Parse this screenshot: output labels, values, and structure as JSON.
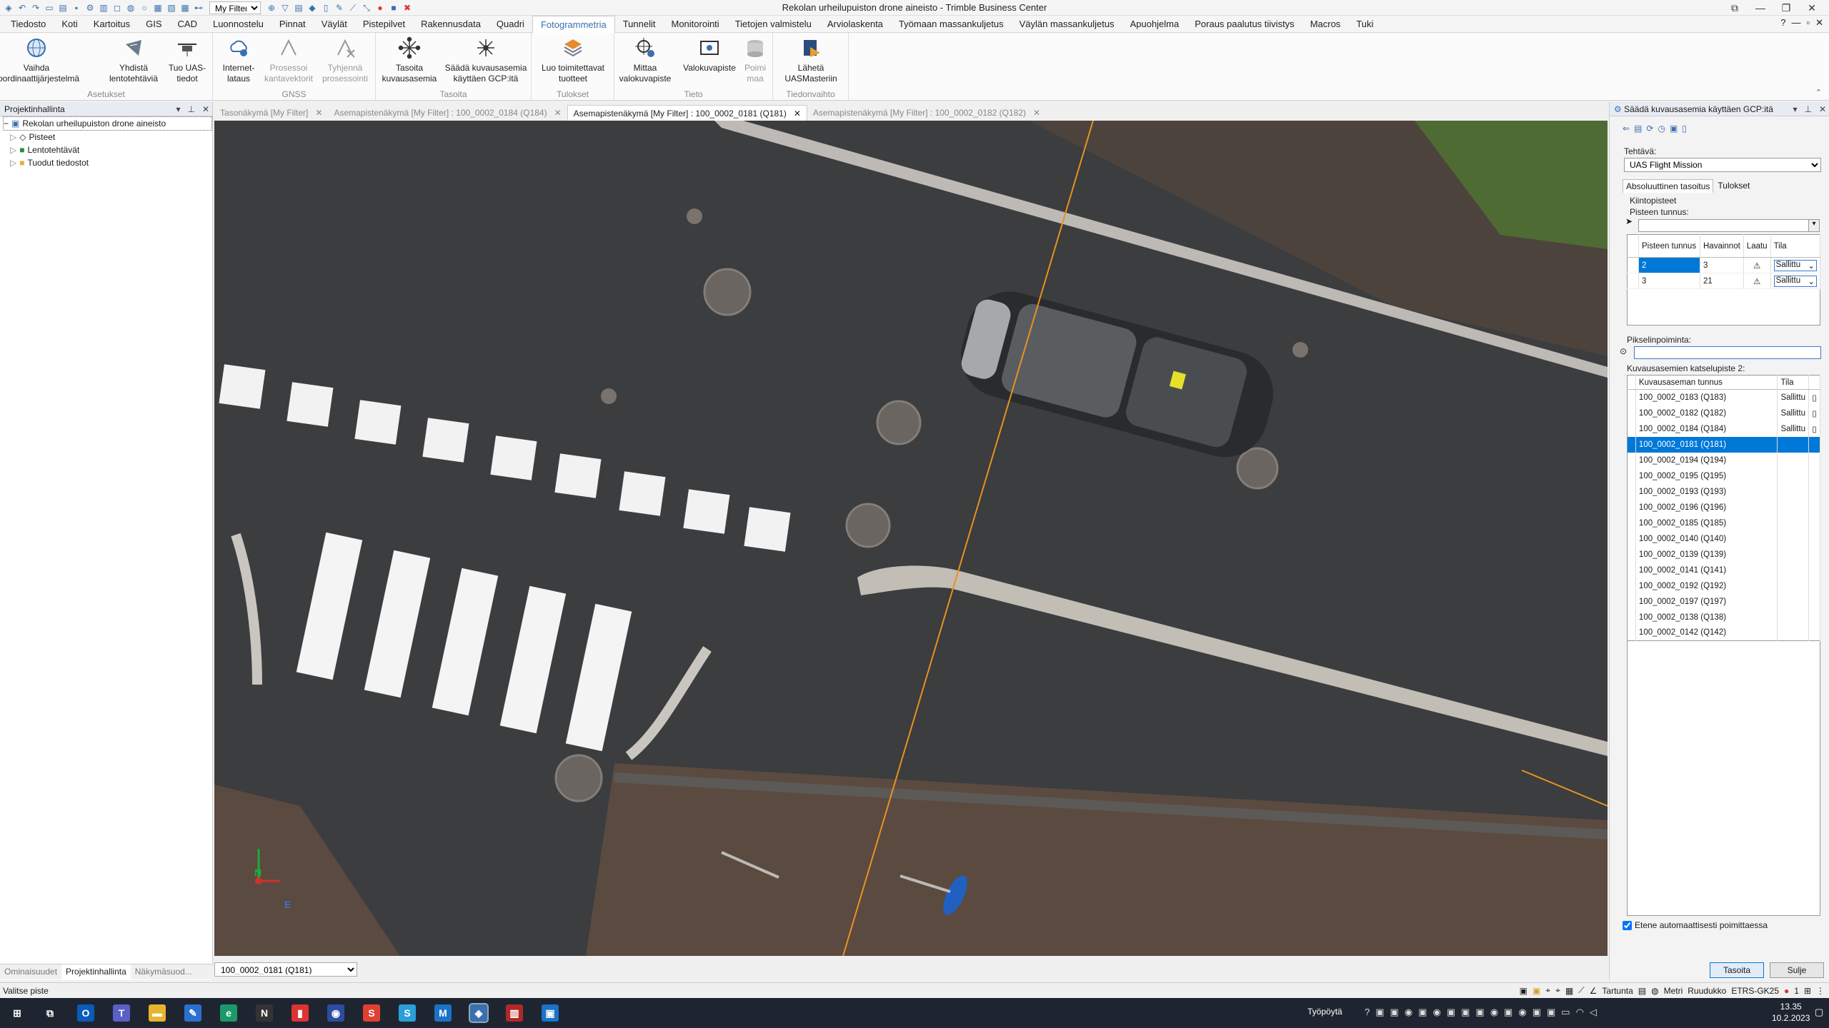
{
  "window": {
    "title": "Rekolan urheilupuiston drone aineisto - Trimble Business Center",
    "filter_value": "My Filter"
  },
  "menu": [
    "Tiedosto",
    "Koti",
    "Kartoitus",
    "GIS",
    "CAD",
    "Luonnostelu",
    "Pinnat",
    "Väylät",
    "Pistepilvet",
    "Rakennusdata",
    "Quadri",
    "Fotogrammetria",
    "Tunnelit",
    "Monitorointi",
    "Tietojen valmistelu",
    "Arviolaskenta",
    "Työmaan massankuljetus",
    "Väylän massankuljetus",
    "Apuohjelma",
    "Poraus paalutus tiivistys",
    "Macros",
    "Tuki"
  ],
  "menu_active": "Fotogrammetria",
  "ribbon": {
    "btn1": "Vaihda koordinaattijärjestelmä",
    "btn2": "Yhdistä lentotehtäviä",
    "btn3": "Tuo UAS-tiedot",
    "grp1": "Asetukset",
    "btn4": "Internet-lataus",
    "btn5": "Prosessoi kantavektorit",
    "btn6": "Tyhjennä prosessointi",
    "grp2": "GNSS",
    "btn7": "Tasoita kuvausasemia",
    "btn8": "Säädä kuvausasemia käyttäen GCP:itä",
    "grp3": "Tasoita",
    "btn9": "Luo toimitettavat tuotteet",
    "grp4": "Tulokset",
    "btn10": "Mittaa valokuvapiste",
    "btn11": "Valokuvapiste",
    "btn12": "Poimi maa",
    "grp5": "Tieto",
    "btn13": "Lähetä UASMasteriin",
    "grp6": "Tiedonvaihto"
  },
  "left": {
    "header": "Projektinhallinta",
    "root": "Rekolan urheilupuiston drone aineisto",
    "items": [
      "Pisteet",
      "Lentotehtävät",
      "Tuodut tiedostot"
    ],
    "tabs": [
      "Ominaisuudet",
      "Projektinhallinta",
      "Näkymäsuod..."
    ]
  },
  "doctabs": [
    "Tasonäkymä [My Filter]",
    "Asemapistenäkymä [My Filter] : 100_0002_0184 (Q184)",
    "Asemapistenäkymä [My Filter] : 100_0002_0181 (Q181)",
    "Asemapistenäkymä [My Filter] : 100_0002_0182 (Q182)"
  ],
  "view": {
    "image_select": "100_0002_0181 (Q181)",
    "north": "N",
    "east": "E"
  },
  "right": {
    "header": "Säädä kuvausasemia käyttäen GCP:itä",
    "task_label": "Tehtävä:",
    "task_value": "UAS Flight Mission",
    "tab1": "Absoluuttinen tasoitus",
    "tab2": "Tulokset",
    "gcp_label": "Kiintopisteet",
    "point_id_label": "Pisteen tunnus:",
    "gcp_cols": [
      "Pisteen tunnus",
      "Havainnot",
      "Laatu",
      "Tila"
    ],
    "gcp_rows": [
      {
        "id": "2",
        "obs": "3",
        "status": "Sallittu"
      },
      {
        "id": "3",
        "obs": "21",
        "status": "Sallittu"
      }
    ],
    "pixel_label": "Pikselinpoiminta:",
    "cam_label": "Kuvausasemien katselupiste 2:",
    "cam_cols": [
      "Kuvausaseman tunnus",
      "Tila"
    ],
    "cam_rows": [
      {
        "id": "100_0002_0183 (Q183)",
        "status": "Sallittu"
      },
      {
        "id": "100_0002_0182 (Q182)",
        "status": "Sallittu"
      },
      {
        "id": "100_0002_0184 (Q184)",
        "status": "Sallittu"
      },
      {
        "id": "100_0002_0181 (Q181)",
        "status": ""
      },
      {
        "id": "100_0002_0194 (Q194)",
        "status": ""
      },
      {
        "id": "100_0002_0195 (Q195)",
        "status": ""
      },
      {
        "id": "100_0002_0193 (Q193)",
        "status": ""
      },
      {
        "id": "100_0002_0196 (Q196)",
        "status": ""
      },
      {
        "id": "100_0002_0185 (Q185)",
        "status": ""
      },
      {
        "id": "100_0002_0140 (Q140)",
        "status": ""
      },
      {
        "id": "100_0002_0139 (Q139)",
        "status": ""
      },
      {
        "id": "100_0002_0141 (Q141)",
        "status": ""
      },
      {
        "id": "100_0002_0192 (Q192)",
        "status": ""
      },
      {
        "id": "100_0002_0197 (Q197)",
        "status": ""
      },
      {
        "id": "100_0002_0138 (Q138)",
        "status": ""
      },
      {
        "id": "100_0002_0142 (Q142)",
        "status": ""
      }
    ],
    "auto_label": "Etene automaattisesti poimittaessa",
    "btn_adjust": "Tasoita",
    "btn_close": "Sulje"
  },
  "status": {
    "left": "Valitse piste",
    "snap": "Tartunta",
    "unit": "Metri",
    "grid": "Ruudukko",
    "crs": "ETRS-GK25",
    "count": "1"
  },
  "taskbar": {
    "workspace": "Työpöytä",
    "time": "13.35",
    "date": "10.2.2023"
  },
  "colors": {
    "accent": "#0078d7",
    "brand": "#3a6fb0"
  }
}
